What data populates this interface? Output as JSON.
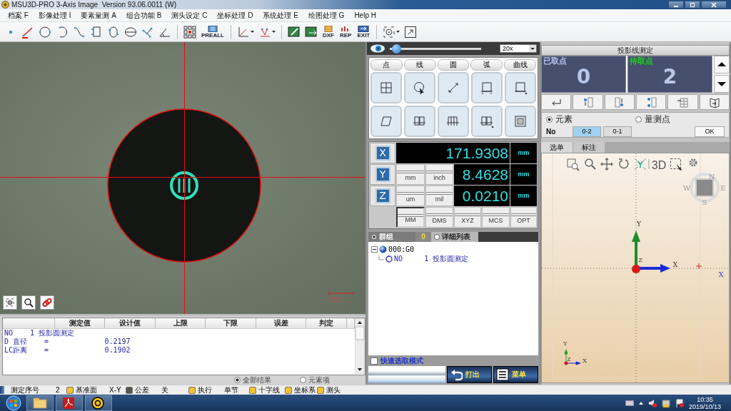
{
  "window": {
    "title": "MSU3D-PRO 3-Axis Image  Version 93.06.0011 (W)"
  },
  "menu": [
    "档案 F",
    "影像处理 I",
    "要素量测 A",
    "组合功能 B",
    "测头设定 C",
    "坐标处理 D",
    "系统处理 E",
    "绘图处理 G",
    "Help H"
  ],
  "toolbar": {
    "icon_labels": [
      "PREALL",
      "DXF",
      "REP",
      "EXIT"
    ]
  },
  "results": {
    "columns": [
      "测定值",
      "设计值",
      "上限",
      "下限",
      "误差",
      "判定"
    ],
    "lines": [
      "NO    1 投影圆测定",
      "D 直径    =             0.2197",
      "LC距离    =             0.1902"
    ],
    "filters": [
      {
        "label": "全部结果",
        "selected": true
      },
      {
        "label": "元素项",
        "selected": false
      }
    ]
  },
  "camera_control": {
    "zoom": {
      "level": 0.03
    },
    "magnification": "20x"
  },
  "feature_tabs": [
    "点",
    "线",
    "圆",
    "弧",
    "曲线"
  ],
  "dro": {
    "axes": [
      {
        "axis": "X",
        "value": "171.9308",
        "unit": "mm"
      },
      {
        "axis": "Y",
        "value": "8.4628",
        "unit": "mm"
      },
      {
        "axis": "Z",
        "value": "0.0210",
        "unit": "mm"
      }
    ],
    "unit_buttons": [
      "mm",
      "inch",
      "um",
      "mil"
    ],
    "mode_buttons": [
      {
        "label": "MM",
        "selected": true
      },
      {
        "label": "DMS",
        "selected": false
      },
      {
        "label": "XYZ",
        "selected": false
      },
      {
        "label": "MCS",
        "selected": false
      },
      {
        "label": "OPT",
        "selected": false
      }
    ]
  },
  "group_panel": {
    "tabs": [
      {
        "label": "群组",
        "selected": true
      },
      {
        "label": "详细列表",
        "selected": false
      }
    ],
    "count": "0",
    "tree": [
      {
        "label": "000:G0",
        "expanded": true,
        "children": [
          {
            "label": "NO     1 投影圆测定"
          }
        ]
      }
    ],
    "quick_select": {
      "label": "快速选取模式",
      "checked": false
    },
    "buttons": [
      "打出",
      "菜单"
    ]
  },
  "measure": {
    "title": "投影线测定",
    "counters": [
      {
        "kind": "taken",
        "label": "已取点",
        "value": "0"
      },
      {
        "kind": "pending",
        "label": "待取点",
        "value": "2"
      }
    ],
    "modes": [
      {
        "label": "元素",
        "selected": true
      },
      {
        "label": "量测点",
        "selected": false
      }
    ],
    "no_label": "No",
    "numbers": [
      {
        "label": "0-2",
        "selected": true
      },
      {
        "label": "0-1",
        "selected": false
      }
    ],
    "ok": "OK"
  },
  "view_tabs": [
    {
      "label": "选单",
      "selected": true
    },
    {
      "label": "标注",
      "selected": false
    }
  ],
  "view3d": {
    "mode_label": "3D",
    "compass": [
      "N",
      "W",
      "E",
      "S"
    ],
    "axes": [
      "Y",
      "X",
      "Z"
    ],
    "mini_axes": [
      "Y",
      "X",
      "Z"
    ],
    "edge_label": "X"
  },
  "status_bar": {
    "sequence": {
      "label": "测定序号",
      "value": "2"
    },
    "toggles": [
      {
        "label": "基准面",
        "value": "X-Y",
        "on": true
      },
      {
        "label": "公差",
        "value": "关",
        "on": false
      },
      {
        "label": "执行",
        "value": "单节",
        "on": true
      },
      {
        "label": "十字线",
        "on": true
      },
      {
        "label": "坐标系",
        "on": true
      },
      {
        "label": "测头",
        "on": true
      }
    ]
  },
  "taskbar": {
    "time": "10:35",
    "date": "2019/10/13"
  }
}
